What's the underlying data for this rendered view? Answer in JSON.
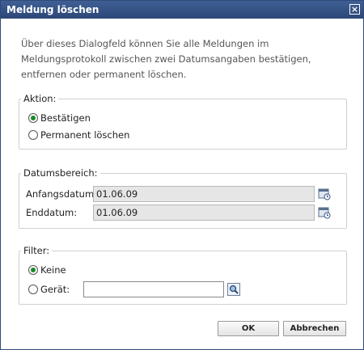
{
  "dialog": {
    "title": "Meldung löschen",
    "close_glyph": "×",
    "description": "Über dieses Dialogfeld können Sie alle Meldungen im Meldungsprotokoll zwischen zwei Datumsangaben bestätigen, entfernen oder permanent löschen."
  },
  "action": {
    "legend": "Aktion:",
    "options": [
      {
        "label": "Bestätigen",
        "selected": true
      },
      {
        "label": "Permanent löschen",
        "selected": false
      }
    ]
  },
  "date_range": {
    "legend": "Datumsbereich:",
    "start_label": "Anfangsdatum:",
    "start_value": "01.06.09",
    "end_label": "Enddatum:",
    "end_value": "01.06.09",
    "calendar_icon": "calendar-icon"
  },
  "filter": {
    "legend": "Filter:",
    "options": [
      {
        "label": "Keine",
        "selected": true
      },
      {
        "label": "Gerät:",
        "selected": false
      }
    ],
    "device_value": "",
    "search_icon": "search-icon"
  },
  "buttons": {
    "ok": "OK",
    "cancel": "Abbrechen"
  },
  "colors": {
    "titlebar": "#35548a",
    "radio_selected": "#1a8a2a"
  }
}
